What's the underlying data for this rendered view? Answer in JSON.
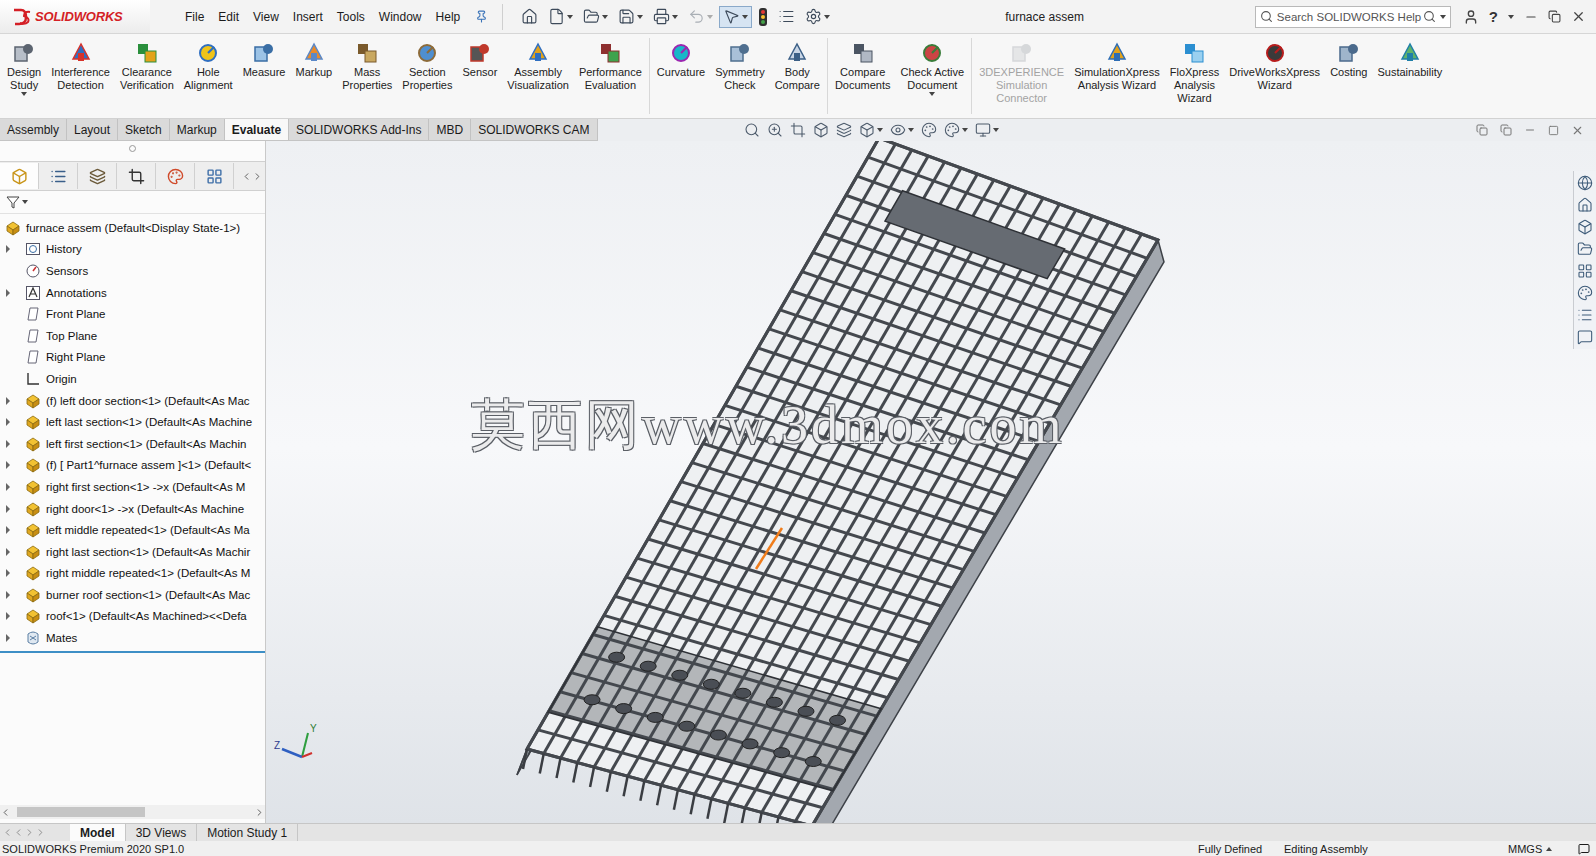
{
  "app": {
    "logo": "SOLIDWORKS"
  },
  "menu": [
    "File",
    "Edit",
    "View",
    "Insert",
    "Tools",
    "Window",
    "Help"
  ],
  "quick_access": [
    {
      "dropdown": false,
      "disabled": false,
      "selected": false
    },
    {
      "dropdown": true,
      "disabled": false,
      "selected": false
    },
    {
      "dropdown": true,
      "disabled": false,
      "selected": false
    },
    {
      "dropdown": true,
      "disabled": false,
      "selected": false
    },
    {
      "dropdown": true,
      "disabled": false,
      "selected": false
    },
    {
      "dropdown": true,
      "disabled": true,
      "selected": false
    },
    {
      "dropdown": true,
      "disabled": false,
      "selected": true
    },
    {
      "dropdown": false,
      "disabled": false,
      "selected": false
    },
    {
      "dropdown": false,
      "disabled": false,
      "selected": false
    },
    {
      "dropdown": true,
      "disabled": false,
      "selected": false
    }
  ],
  "window": {
    "title": "furnace assem"
  },
  "search": {
    "placeholder": "Search SOLIDWORKS Help"
  },
  "help": "?",
  "ribbon_groups": [
    [
      {
        "lines": [
          "Design",
          "Study"
        ],
        "disabled": false,
        "dropdown": true
      },
      {
        "lines": [
          "Interference",
          "Detection"
        ],
        "disabled": false,
        "dropdown": false
      },
      {
        "lines": [
          "Clearance",
          "Verification"
        ],
        "disabled": false,
        "dropdown": false
      },
      {
        "lines": [
          "Hole",
          "Alignment"
        ],
        "disabled": false,
        "dropdown": false
      },
      {
        "lines": [
          "Measure"
        ],
        "disabled": false,
        "dropdown": false
      },
      {
        "lines": [
          "Markup"
        ],
        "disabled": false,
        "dropdown": false
      },
      {
        "lines": [
          "Mass",
          "Properties"
        ],
        "disabled": false,
        "dropdown": false
      },
      {
        "lines": [
          "Section",
          "Properties"
        ],
        "disabled": false,
        "dropdown": false
      },
      {
        "lines": [
          "Sensor"
        ],
        "disabled": false,
        "dropdown": false
      },
      {
        "lines": [
          "Assembly",
          "Visualization"
        ],
        "disabled": false,
        "dropdown": false
      },
      {
        "lines": [
          "Performance",
          "Evaluation"
        ],
        "disabled": false,
        "dropdown": false
      }
    ],
    [
      {
        "lines": [
          "Curvature"
        ],
        "disabled": false,
        "dropdown": false
      },
      {
        "lines": [
          "Symmetry",
          "Check"
        ],
        "disabled": false,
        "dropdown": false
      },
      {
        "lines": [
          "Body",
          "Compare"
        ],
        "disabled": false,
        "dropdown": false
      }
    ],
    [
      {
        "lines": [
          "Compare",
          "Documents"
        ],
        "disabled": false,
        "dropdown": false
      },
      {
        "lines": [
          "Check Active",
          "Document"
        ],
        "disabled": false,
        "dropdown": true
      }
    ],
    [
      {
        "lines": [
          "3DEXPERIENCE",
          "Simulation",
          "Connector"
        ],
        "disabled": true,
        "dropdown": false
      },
      {
        "lines": [
          "SimulationXpress",
          "Analysis Wizard"
        ],
        "disabled": false,
        "dropdown": false
      },
      {
        "lines": [
          "FloXpress",
          "Analysis",
          "Wizard"
        ],
        "disabled": false,
        "dropdown": false
      },
      {
        "lines": [
          "DriveWorksXpress",
          "Wizard"
        ],
        "disabled": false,
        "dropdown": false
      },
      {
        "lines": [
          "Costing"
        ],
        "disabled": false,
        "dropdown": false
      },
      {
        "lines": [
          "Sustainability"
        ],
        "disabled": false,
        "dropdown": false
      }
    ]
  ],
  "command_tabs": [
    {
      "label": "Assembly",
      "selected": false
    },
    {
      "label": "Layout",
      "selected": false
    },
    {
      "label": "Sketch",
      "selected": false
    },
    {
      "label": "Markup",
      "selected": false
    },
    {
      "label": "Evaluate",
      "selected": true
    },
    {
      "label": "SOLIDWORKS Add-Ins",
      "selected": false
    },
    {
      "label": "MBD",
      "selected": false
    },
    {
      "label": "SOLIDWORKS CAM",
      "selected": false
    }
  ],
  "tree": {
    "root": "furnace assem  (Default<Display State-1>)",
    "items": [
      {
        "label": "History",
        "kind": "history",
        "expandable": true
      },
      {
        "label": "Sensors",
        "kind": "sensor",
        "expandable": false
      },
      {
        "label": "Annotations",
        "kind": "annotation",
        "expandable": true
      },
      {
        "label": "Front Plane",
        "kind": "plane",
        "expandable": false
      },
      {
        "label": "Top Plane",
        "kind": "plane",
        "expandable": false
      },
      {
        "label": "Right Plane",
        "kind": "plane",
        "expandable": false
      },
      {
        "label": "Origin",
        "kind": "origin",
        "expandable": false
      },
      {
        "label": "(f) left door section<1> (Default<As Mac",
        "kind": "part",
        "expandable": true
      },
      {
        "label": "left last section<1> (Default<As Machine",
        "kind": "part",
        "expandable": true
      },
      {
        "label": "left first section<1> (Default<As Machin",
        "kind": "part",
        "expandable": true
      },
      {
        "label": "(f) [ Part1^furnace assem ]<1> (Default<",
        "kind": "part",
        "expandable": true
      },
      {
        "label": "right first section<1> ->x (Default<As M",
        "kind": "part",
        "expandable": true
      },
      {
        "label": "right  door<1> ->x (Default<As Machine",
        "kind": "part",
        "expandable": true
      },
      {
        "label": "left middle repeated<1> (Default<As Ma",
        "kind": "part",
        "expandable": true
      },
      {
        "label": "right last section<1> (Default<As Machir",
        "kind": "part",
        "expandable": true
      },
      {
        "label": "right middle repeated<1> (Default<As M",
        "kind": "part",
        "expandable": true
      },
      {
        "label": "burner roof section<1> (Default<As Mac",
        "kind": "part",
        "expandable": true
      },
      {
        "label": "roof<1> (Default<As Machined><<Defa",
        "kind": "part",
        "expandable": true
      },
      {
        "label": "Mates",
        "kind": "mates",
        "expandable": true
      }
    ]
  },
  "viewport": {
    "watermark": "莫西网www.3dmox.com",
    "triad": [
      "Z",
      "Y"
    ]
  },
  "bottom_tabs": [
    {
      "label": "Model",
      "selected": true
    },
    {
      "label": "3D Views",
      "selected": false
    },
    {
      "label": "Motion Study 1",
      "selected": false
    }
  ],
  "status_bar": {
    "product": "SOLIDWORKS Premium 2020 SP1.0",
    "fields": [
      "Fully Defined",
      "Editing Assembly",
      "MMGS"
    ]
  }
}
